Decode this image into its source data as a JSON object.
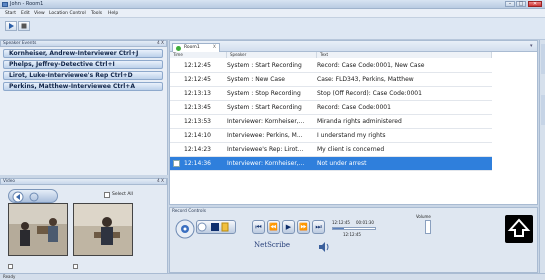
{
  "window": {
    "title": "John - Room1"
  },
  "menu": [
    "Start",
    "Edit",
    "View",
    "Location Control",
    "Tools",
    "Help"
  ],
  "speaker_panel": {
    "title": "Speaker Events",
    "close": "4 X",
    "items": [
      "Kornheiser, Andrew-Interviewer Ctrl+J",
      "Phelps, Jeffrey-Detective Ctrl+I",
      "Lirot, Luke-Interviewee's Rep Ctrl+D",
      "Perkins, Matthew-Interviewee Ctrl+A"
    ]
  },
  "events": {
    "tab_label": "Room1",
    "tab_close": "X",
    "columns": [
      "Time",
      "Speaker",
      "Text"
    ],
    "rows": [
      {
        "time": "12:12:45",
        "speaker": "System : Start Recording",
        "text": "Record: Case Code:0001, New Case"
      },
      {
        "time": "12:12:45",
        "speaker": "System : New Case",
        "text": "Case: FLD343, Perkins, Matthew"
      },
      {
        "time": "12:13:13",
        "speaker": "System : Stop Recording",
        "text": "Stop (Off Record): Case Code:0001"
      },
      {
        "time": "12:13:45",
        "speaker": "System : Start Recording",
        "text": "Record: Case Code:0001"
      },
      {
        "time": "12:13:53",
        "speaker": "Interviewer: Kornheiser,...",
        "text": "Miranda rights administered"
      },
      {
        "time": "12:14:10",
        "speaker": "Interviewee: Perkins, M...",
        "text": "I understand my rights"
      },
      {
        "time": "12:14:23",
        "speaker": "Interviewee's Rep: Lirot...",
        "text": "My client is concerned"
      },
      {
        "time": "12:14:36",
        "speaker": "Interviewer: Kornheiser,...",
        "text": "Not under arrest"
      }
    ]
  },
  "video": {
    "title": "Video",
    "close": "4 X",
    "select_all": "Select All"
  },
  "record_controls": {
    "title": "Record Controls",
    "time_start": "12:12:45",
    "time_elapsed": "00:01:30",
    "time_current": "12:12:45",
    "volume_label": "Volume",
    "logo": "NetScribe",
    "progress": 0.25
  },
  "status": {
    "text": "Ready"
  }
}
